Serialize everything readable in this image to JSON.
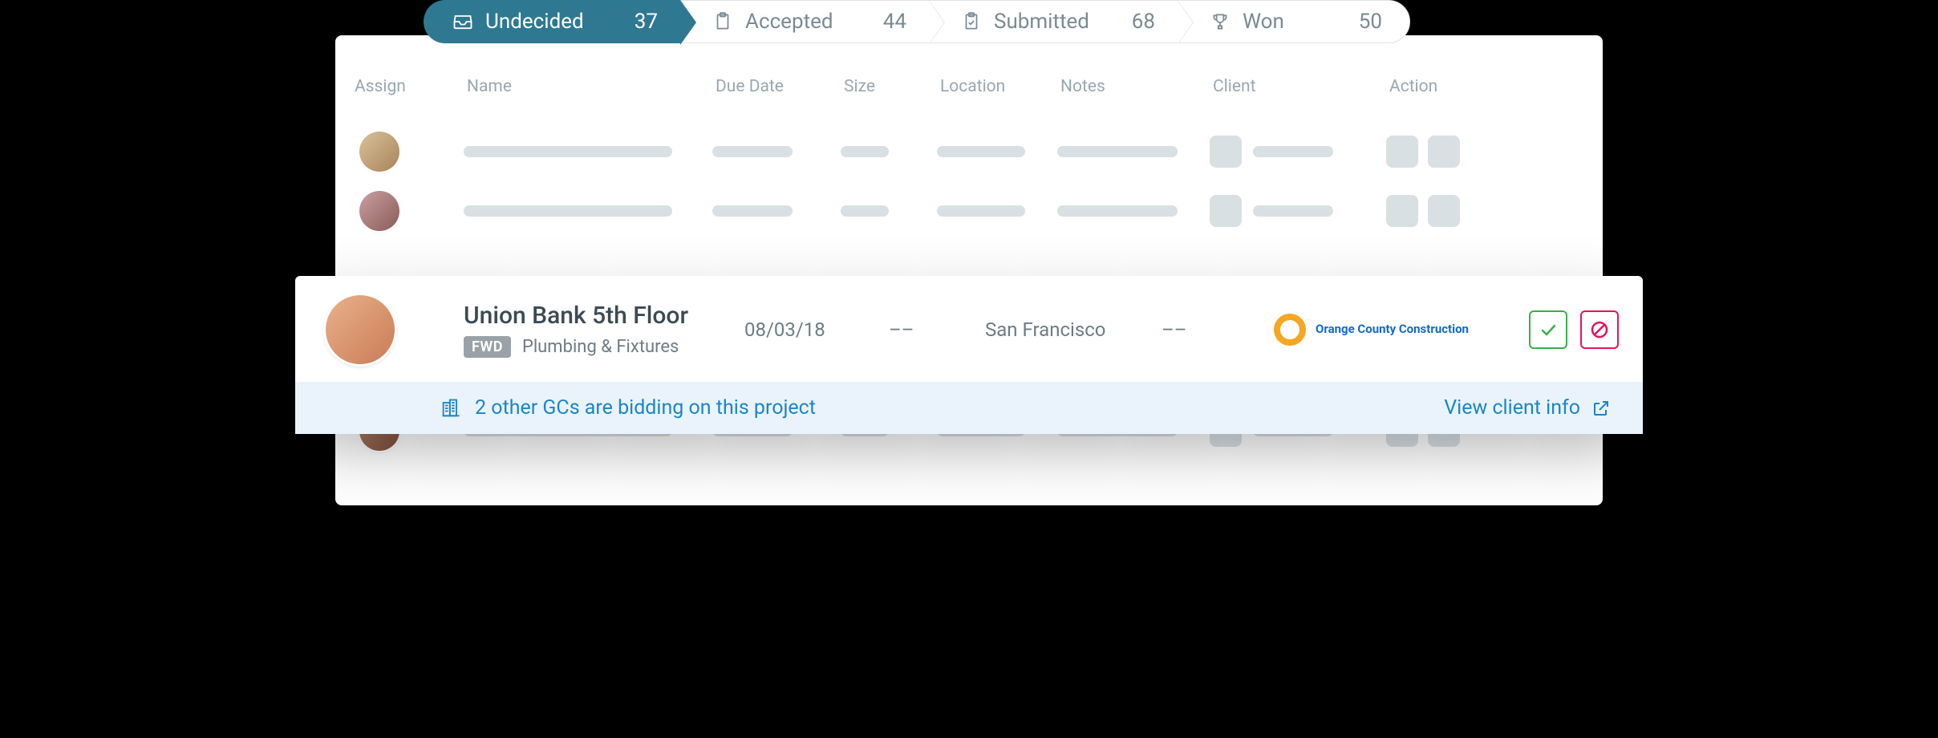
{
  "tabs": [
    {
      "id": "undecided",
      "label": "Undecided",
      "count": 37,
      "active": true,
      "icon": "inbox"
    },
    {
      "id": "accepted",
      "label": "Accepted",
      "count": 44,
      "active": false,
      "icon": "clipboard"
    },
    {
      "id": "submitted",
      "label": "Submitted",
      "count": 68,
      "active": false,
      "icon": "clipboard-check"
    },
    {
      "id": "won",
      "label": "Won",
      "count": 50,
      "active": false,
      "icon": "trophy"
    }
  ],
  "columns": {
    "assign": "Assign",
    "name": "Name",
    "due_date": "Due Date",
    "size": "Size",
    "location": "Location",
    "notes": "Notes",
    "client": "Client",
    "action": "Action"
  },
  "expanded_row": {
    "title": "Union Bank 5th Floor",
    "badge": "FWD",
    "subtitle": "Plumbing & Fixtures",
    "due_date": "08/03/18",
    "size": "––",
    "location": "San Francisco",
    "notes": "––",
    "client": {
      "name": "Orange County Construction",
      "logo_color": "#f5a623"
    },
    "footer_message": "2 other GCs are bidding on this project",
    "view_client_label": "View client info"
  }
}
